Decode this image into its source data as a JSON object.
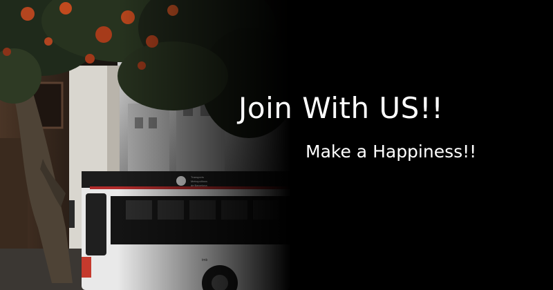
{
  "banner": {
    "headline": "Join With US!!",
    "tagline": "Make a Happiness!!",
    "background_color": "#000000",
    "text_color": "#ffffff"
  },
  "photo": {
    "bus_sign_line1": "Transports",
    "bus_sign_line2": "Metropolitans",
    "bus_sign_line3": "de Barcelona",
    "bus_logo_text": "tmb"
  }
}
